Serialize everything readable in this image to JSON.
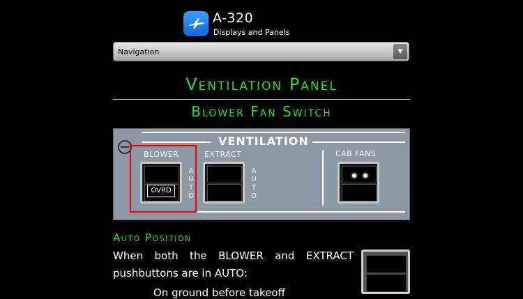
{
  "header": {
    "app_title": "A-320",
    "app_subtitle": "Displays and Panels",
    "icon": "airplane-icon",
    "icon_color": "#1e7ff0"
  },
  "navigation": {
    "selected": "Navigation",
    "arrow": "▼"
  },
  "page": {
    "title": "Ventilation Panel",
    "subtitle": "Blower Fan Switch",
    "accent_color": "#1fe01f"
  },
  "panel": {
    "title": "VENTILATION",
    "blower_label": "BLOWER",
    "extract_label": "EXTRACT",
    "cab_fans_label": "CAB FANS",
    "auto_letters": [
      "A",
      "U",
      "T",
      "O"
    ],
    "ovrd_label": "OVRD",
    "highlight_color": "#e00000"
  },
  "auto_section": {
    "heading": "Auto Position",
    "paragraph": "When both the BLOWER and EXTRACT pushbuttons are in AUTO:",
    "partial_line": "On ground before takeoff"
  }
}
